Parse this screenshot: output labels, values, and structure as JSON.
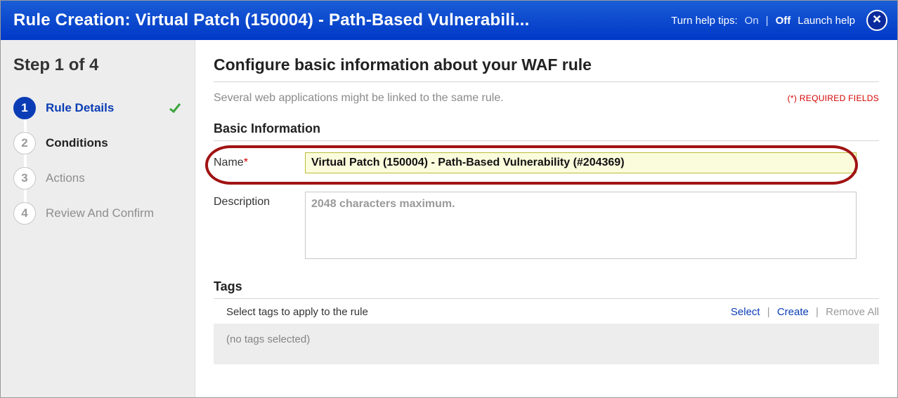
{
  "header": {
    "title": "Rule Creation: Virtual Patch (150004) - Path-Based Vulnerabili...",
    "tips_label": "Turn help tips:",
    "tips_on": "On",
    "tips_off": "Off",
    "launch_help": "Launch help"
  },
  "wizard": {
    "step_of": "Step 1 of 4",
    "steps": [
      {
        "num": "1",
        "label": "Rule Details",
        "active": true,
        "checked": true
      },
      {
        "num": "2",
        "label": "Conditions",
        "enabled": true
      },
      {
        "num": "3",
        "label": "Actions"
      },
      {
        "num": "4",
        "label": "Review And Confirm"
      }
    ]
  },
  "main": {
    "heading": "Configure basic information about your WAF rule",
    "subtitle": "Several web applications might be linked to the same rule.",
    "required_note": "(*) REQUIRED FIELDS",
    "section_basic": "Basic Information",
    "name_label": "Name",
    "name_value": "Virtual Patch (150004) - Path-Based Vulnerability (#204369)",
    "desc_label": "Description",
    "desc_placeholder": "2048 characters maximum.",
    "section_tags": "Tags",
    "tags_instruction": "Select tags to apply to the rule",
    "tags_select": "Select",
    "tags_create": "Create",
    "tags_remove": "Remove All",
    "tags_empty": "(no tags selected)"
  }
}
